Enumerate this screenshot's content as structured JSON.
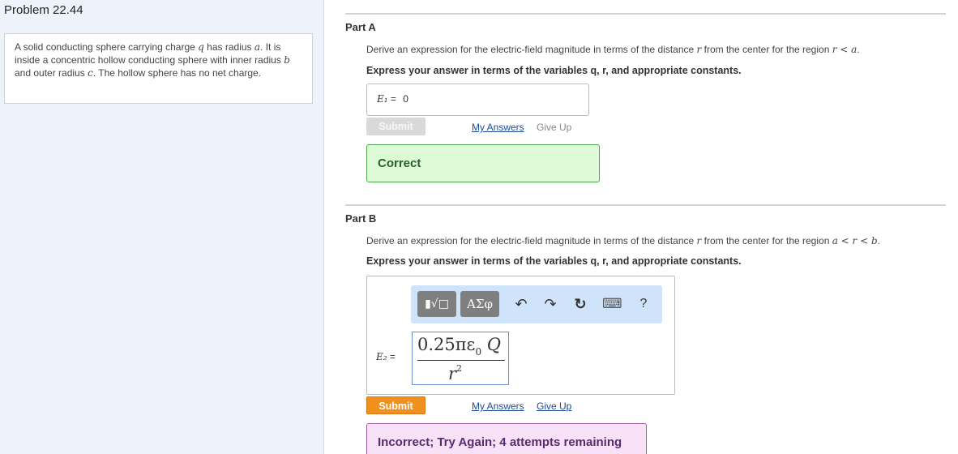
{
  "problem": {
    "title": "Problem 22.44",
    "statement_parts": [
      "A solid conducting sphere carrying charge ",
      "q",
      " has radius ",
      "a",
      ". It is inside a concentric hollow conducting sphere with inner radius ",
      "b",
      " and outer radius ",
      "c",
      ". The hollow sphere has no net charge."
    ]
  },
  "part_a": {
    "label": "Part A",
    "question_prefix": "Derive an expression for the electric-field magnitude in terms of the distance ",
    "question_var": "r",
    "question_mid": " from the center for the region ",
    "question_region": "r < a",
    "question_end": ".",
    "instruction": "Express your answer in terms of the variables q, r, and appropriate constants.",
    "answer_label": "E₁",
    "answer_eq": "=",
    "answer_value": "0",
    "submit_label": "Submit",
    "my_answers_label": "My Answers",
    "give_up_label": "Give Up",
    "feedback": "Correct"
  },
  "part_b": {
    "label": "Part B",
    "question_prefix": "Derive an expression for the electric-field magnitude in terms of the distance ",
    "question_var": "r",
    "question_mid": " from the center for the region ",
    "question_region": "a < r < b",
    "question_end": ".",
    "instruction": "Express your answer in terms of the variables q, r, and appropriate constants.",
    "toolbar": {
      "template_button": "▮√□",
      "symbols_button": "ΑΣφ",
      "undo_icon": "↶",
      "redo_icon": "↷",
      "reset_icon": "↻",
      "keyboard_icon": "⌨",
      "help_icon": "?"
    },
    "answer_label": "E₂",
    "answer_eq": "=",
    "formula_numerator": "0.25πε",
    "formula_sub": "0",
    "formula_Q": "Q",
    "formula_denominator": "r",
    "formula_power": "2",
    "submit_label": "Submit",
    "my_answers_label": "My Answers",
    "give_up_label": "Give Up",
    "feedback": "Incorrect; Try Again; 4 attempts remaining"
  },
  "colors": {
    "submit_active": "#f0901e",
    "correct_bg": "#ddfbd6",
    "incorrect_bg": "#f8e2f7",
    "link": "#1a4a9a"
  }
}
